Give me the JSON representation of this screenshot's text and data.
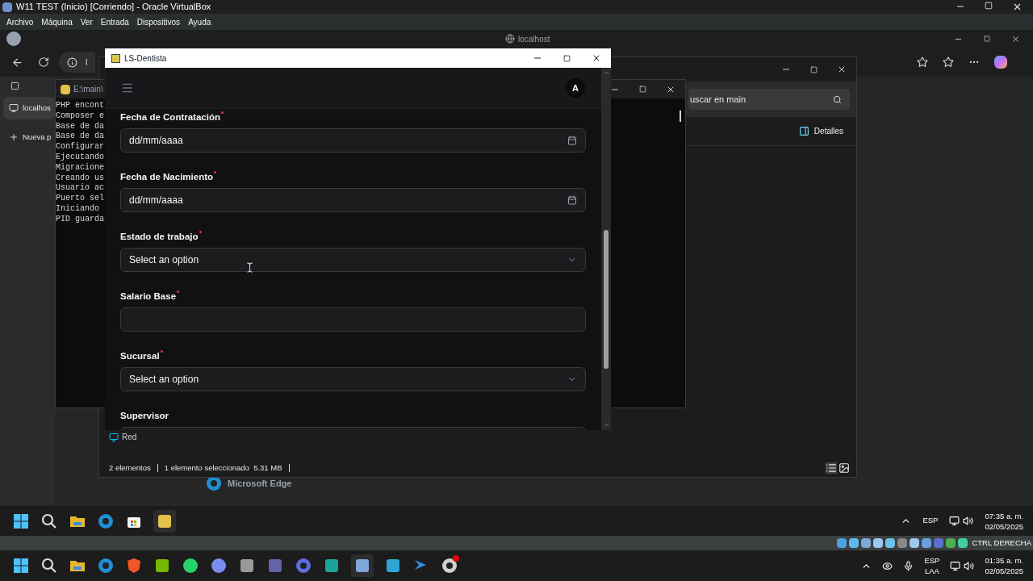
{
  "host_window": {
    "title": "W11 TEST (Inicio) [Corriendo] - Oracle VirtualBox",
    "menu": [
      "Archivo",
      "Máquina",
      "Ver",
      "Entrada",
      "Dispositivos",
      "Ayuda"
    ]
  },
  "browser": {
    "address": "localhost",
    "url_visible": "l",
    "tabs": [
      {
        "label": "localhos",
        "selected": true
      },
      {
        "label": "Nueva p",
        "selected": false
      }
    ]
  },
  "explorer": {
    "search_placeholder": "uscar en main",
    "details_button": "Detalles",
    "nav_item": "Red",
    "status_count": "2 elementos",
    "status_selection": "1 elemento seleccionado  5.31 MB"
  },
  "terminal": {
    "title": "E:\\main\\",
    "lines": [
      "PHP encont",
      "Composer e",
      "Base de da",
      "Base de da",
      "Configurar",
      "Ejecutando",
      "Migracione",
      "Creando us",
      "Usuario ac",
      "Puerto sel",
      "Iniciando",
      "PID guarda"
    ]
  },
  "app": {
    "title": "LS-Dentista",
    "avatar": "A",
    "fields": [
      {
        "label": "Fecha de Contratación",
        "required": true,
        "kind": "date",
        "placeholder": "dd/mm/aaaa"
      },
      {
        "label": "Fecha de Nacimiento",
        "required": true,
        "kind": "date",
        "placeholder": "dd/mm/aaaa"
      },
      {
        "label": "Estado de trabajo",
        "required": true,
        "kind": "select",
        "placeholder": "Select an option"
      },
      {
        "label": "Salario Base",
        "required": true,
        "kind": "text"
      },
      {
        "label": "Sucursal",
        "required": true,
        "kind": "select",
        "placeholder": "Select an option"
      },
      {
        "label": "Supervisor",
        "required": false,
        "kind": "text"
      }
    ]
  },
  "desktop_shortcut": "Microsoft Edge",
  "guest_taskbar": {
    "language": "ESP",
    "time": "07:35 a. m.",
    "date": "02/05/2025"
  },
  "vbox_status": {
    "hotkey": "CTRL DERECHA"
  },
  "host_taskbar": {
    "language": "ESP",
    "layout": "LAA",
    "time": "01:35 a. m.",
    "date": "02/05/2025"
  }
}
